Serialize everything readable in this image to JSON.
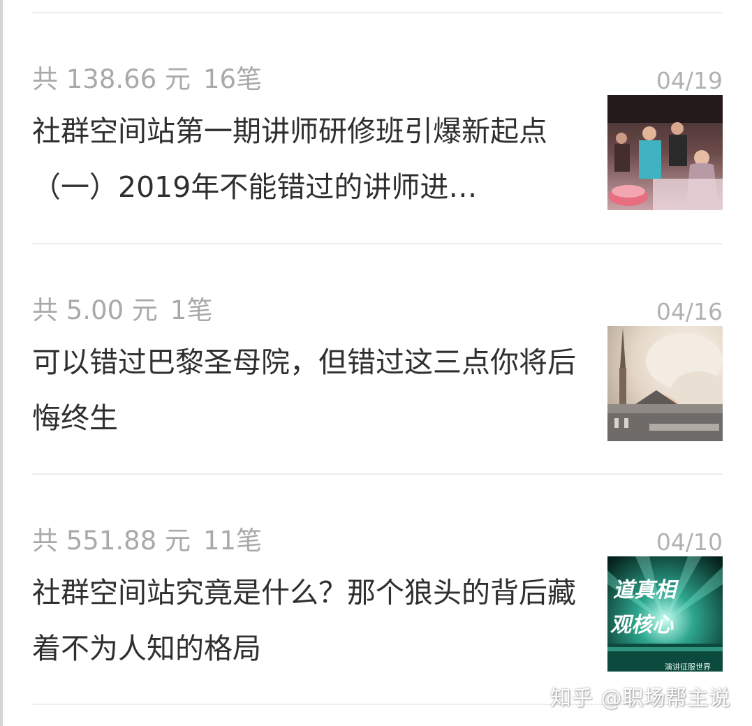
{
  "records": [
    {
      "total_prefix": "共",
      "amount": "138.66 元",
      "count": "16笔",
      "date": "04/19",
      "title": "社群空间站第一期讲师研修班引爆新起点（一）2019年不能错过的讲师进…",
      "thumbnail": "party-photo"
    },
    {
      "total_prefix": "共",
      "amount": "5.00 元",
      "count": "1笔",
      "date": "04/16",
      "title": "可以错过巴黎圣母院，但错过这三点你将后悔终生",
      "thumbnail": "notre-dame-fire-photo"
    },
    {
      "total_prefix": "共",
      "amount": "551.88 元",
      "count": "11笔",
      "date": "04/10",
      "title": "社群空间站究竟是什么？那个狼头的背后藏着不为人知的格局",
      "thumbnail": "light-rays-photo",
      "thumbnail_text": [
        "道真相",
        "观核心",
        "演讲征服世界"
      ]
    }
  ],
  "watermark": "知乎 @职场帮主说",
  "colors": {
    "meta_text": "#a9a9a9",
    "date_text": "#b1b1b1",
    "title_text": "#2f2f2f",
    "divider": "#ececec"
  }
}
